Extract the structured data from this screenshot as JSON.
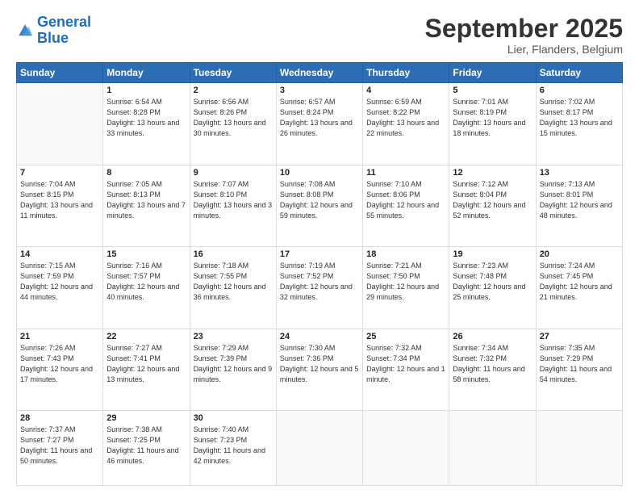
{
  "header": {
    "logo_line1": "General",
    "logo_line2": "Blue",
    "month": "September 2025",
    "location": "Lier, Flanders, Belgium"
  },
  "weekdays": [
    "Sunday",
    "Monday",
    "Tuesday",
    "Wednesday",
    "Thursday",
    "Friday",
    "Saturday"
  ],
  "weeks": [
    [
      {
        "day": "",
        "sunrise": "",
        "sunset": "",
        "daylight": ""
      },
      {
        "day": "1",
        "sunrise": "Sunrise: 6:54 AM",
        "sunset": "Sunset: 8:28 PM",
        "daylight": "Daylight: 13 hours and 33 minutes."
      },
      {
        "day": "2",
        "sunrise": "Sunrise: 6:56 AM",
        "sunset": "Sunset: 8:26 PM",
        "daylight": "Daylight: 13 hours and 30 minutes."
      },
      {
        "day": "3",
        "sunrise": "Sunrise: 6:57 AM",
        "sunset": "Sunset: 8:24 PM",
        "daylight": "Daylight: 13 hours and 26 minutes."
      },
      {
        "day": "4",
        "sunrise": "Sunrise: 6:59 AM",
        "sunset": "Sunset: 8:22 PM",
        "daylight": "Daylight: 13 hours and 22 minutes."
      },
      {
        "day": "5",
        "sunrise": "Sunrise: 7:01 AM",
        "sunset": "Sunset: 8:19 PM",
        "daylight": "Daylight: 13 hours and 18 minutes."
      },
      {
        "day": "6",
        "sunrise": "Sunrise: 7:02 AM",
        "sunset": "Sunset: 8:17 PM",
        "daylight": "Daylight: 13 hours and 15 minutes."
      }
    ],
    [
      {
        "day": "7",
        "sunrise": "Sunrise: 7:04 AM",
        "sunset": "Sunset: 8:15 PM",
        "daylight": "Daylight: 13 hours and 11 minutes."
      },
      {
        "day": "8",
        "sunrise": "Sunrise: 7:05 AM",
        "sunset": "Sunset: 8:13 PM",
        "daylight": "Daylight: 13 hours and 7 minutes."
      },
      {
        "day": "9",
        "sunrise": "Sunrise: 7:07 AM",
        "sunset": "Sunset: 8:10 PM",
        "daylight": "Daylight: 13 hours and 3 minutes."
      },
      {
        "day": "10",
        "sunrise": "Sunrise: 7:08 AM",
        "sunset": "Sunset: 8:08 PM",
        "daylight": "Daylight: 12 hours and 59 minutes."
      },
      {
        "day": "11",
        "sunrise": "Sunrise: 7:10 AM",
        "sunset": "Sunset: 8:06 PM",
        "daylight": "Daylight: 12 hours and 55 minutes."
      },
      {
        "day": "12",
        "sunrise": "Sunrise: 7:12 AM",
        "sunset": "Sunset: 8:04 PM",
        "daylight": "Daylight: 12 hours and 52 minutes."
      },
      {
        "day": "13",
        "sunrise": "Sunrise: 7:13 AM",
        "sunset": "Sunset: 8:01 PM",
        "daylight": "Daylight: 12 hours and 48 minutes."
      }
    ],
    [
      {
        "day": "14",
        "sunrise": "Sunrise: 7:15 AM",
        "sunset": "Sunset: 7:59 PM",
        "daylight": "Daylight: 12 hours and 44 minutes."
      },
      {
        "day": "15",
        "sunrise": "Sunrise: 7:16 AM",
        "sunset": "Sunset: 7:57 PM",
        "daylight": "Daylight: 12 hours and 40 minutes."
      },
      {
        "day": "16",
        "sunrise": "Sunrise: 7:18 AM",
        "sunset": "Sunset: 7:55 PM",
        "daylight": "Daylight: 12 hours and 36 minutes."
      },
      {
        "day": "17",
        "sunrise": "Sunrise: 7:19 AM",
        "sunset": "Sunset: 7:52 PM",
        "daylight": "Daylight: 12 hours and 32 minutes."
      },
      {
        "day": "18",
        "sunrise": "Sunrise: 7:21 AM",
        "sunset": "Sunset: 7:50 PM",
        "daylight": "Daylight: 12 hours and 29 minutes."
      },
      {
        "day": "19",
        "sunrise": "Sunrise: 7:23 AM",
        "sunset": "Sunset: 7:48 PM",
        "daylight": "Daylight: 12 hours and 25 minutes."
      },
      {
        "day": "20",
        "sunrise": "Sunrise: 7:24 AM",
        "sunset": "Sunset: 7:45 PM",
        "daylight": "Daylight: 12 hours and 21 minutes."
      }
    ],
    [
      {
        "day": "21",
        "sunrise": "Sunrise: 7:26 AM",
        "sunset": "Sunset: 7:43 PM",
        "daylight": "Daylight: 12 hours and 17 minutes."
      },
      {
        "day": "22",
        "sunrise": "Sunrise: 7:27 AM",
        "sunset": "Sunset: 7:41 PM",
        "daylight": "Daylight: 12 hours and 13 minutes."
      },
      {
        "day": "23",
        "sunrise": "Sunrise: 7:29 AM",
        "sunset": "Sunset: 7:39 PM",
        "daylight": "Daylight: 12 hours and 9 minutes."
      },
      {
        "day": "24",
        "sunrise": "Sunrise: 7:30 AM",
        "sunset": "Sunset: 7:36 PM",
        "daylight": "Daylight: 12 hours and 5 minutes."
      },
      {
        "day": "25",
        "sunrise": "Sunrise: 7:32 AM",
        "sunset": "Sunset: 7:34 PM",
        "daylight": "Daylight: 12 hours and 1 minute."
      },
      {
        "day": "26",
        "sunrise": "Sunrise: 7:34 AM",
        "sunset": "Sunset: 7:32 PM",
        "daylight": "Daylight: 11 hours and 58 minutes."
      },
      {
        "day": "27",
        "sunrise": "Sunrise: 7:35 AM",
        "sunset": "Sunset: 7:29 PM",
        "daylight": "Daylight: 11 hours and 54 minutes."
      }
    ],
    [
      {
        "day": "28",
        "sunrise": "Sunrise: 7:37 AM",
        "sunset": "Sunset: 7:27 PM",
        "daylight": "Daylight: 11 hours and 50 minutes."
      },
      {
        "day": "29",
        "sunrise": "Sunrise: 7:38 AM",
        "sunset": "Sunset: 7:25 PM",
        "daylight": "Daylight: 11 hours and 46 minutes."
      },
      {
        "day": "30",
        "sunrise": "Sunrise: 7:40 AM",
        "sunset": "Sunset: 7:23 PM",
        "daylight": "Daylight: 11 hours and 42 minutes."
      },
      {
        "day": "",
        "sunrise": "",
        "sunset": "",
        "daylight": ""
      },
      {
        "day": "",
        "sunrise": "",
        "sunset": "",
        "daylight": ""
      },
      {
        "day": "",
        "sunrise": "",
        "sunset": "",
        "daylight": ""
      },
      {
        "day": "",
        "sunrise": "",
        "sunset": "",
        "daylight": ""
      }
    ]
  ]
}
